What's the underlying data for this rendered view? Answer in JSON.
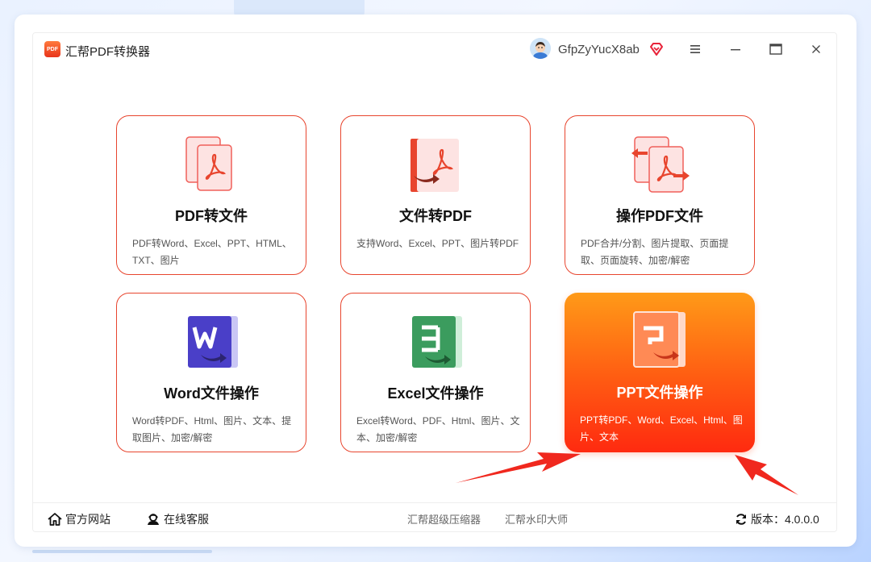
{
  "app": {
    "title": "汇帮PDF转换器",
    "logo_text": "PDF"
  },
  "user": {
    "name": "GfpZyYucX8ab"
  },
  "colors": {
    "accent": "#e8452e",
    "active_top": "#ff9a18",
    "active_bottom": "#ff2a10",
    "arrow": "#f0281e"
  },
  "cards": [
    {
      "title": "PDF转文件",
      "desc": "PDF转Word、Excel、PPT、HTML、TXT、图片",
      "icon": "pdf-to-file-icon"
    },
    {
      "title": "文件转PDF",
      "desc": "支持Word、Excel、PPT、图片转PDF",
      "icon": "file-to-pdf-icon"
    },
    {
      "title": "操作PDF文件",
      "desc": "PDF合并/分割、图片提取、页面提取、页面旋转、加密/解密",
      "icon": "pdf-operate-icon"
    },
    {
      "title": "Word文件操作",
      "desc": "Word转PDF、Html、图片、文本、提取图片、加密/解密",
      "icon": "word-icon"
    },
    {
      "title": "Excel文件操作",
      "desc": "Excel转Word、PDF、Html、图片、文本、加密/解密",
      "icon": "excel-icon"
    },
    {
      "title": "PPT文件操作",
      "desc": "PPT转PDF、Word、Excel、Html、图片、文本",
      "icon": "ppt-icon"
    }
  ],
  "footer": {
    "website": "官方网站",
    "support": "在线客服",
    "link1": "汇帮超级压缩器",
    "link2": "汇帮水印大师",
    "version": "版本：4.0.0.0"
  }
}
